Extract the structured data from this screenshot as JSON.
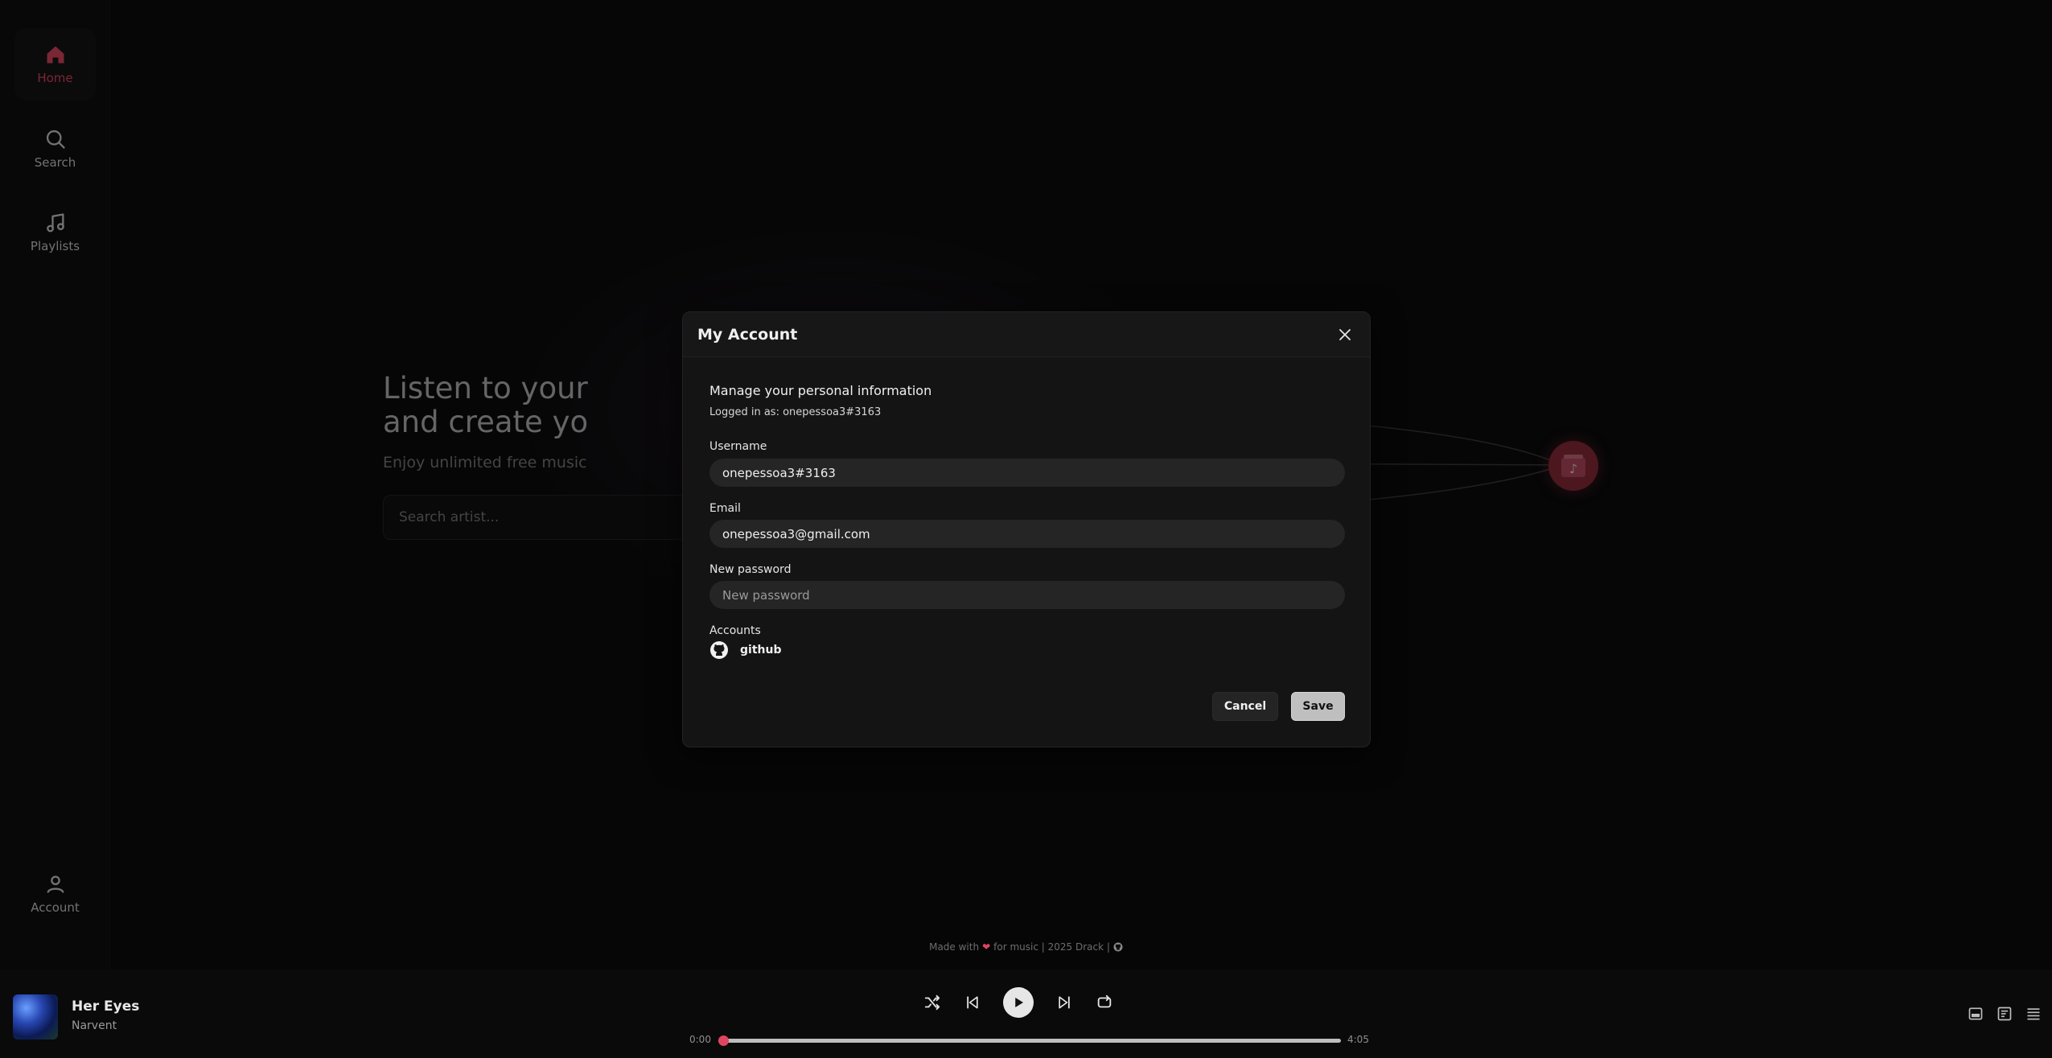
{
  "sidebar": {
    "items": [
      {
        "label": "Home",
        "icon": "home-icon",
        "active": true
      },
      {
        "label": "Search",
        "icon": "search-icon",
        "active": false
      },
      {
        "label": "Playlists",
        "icon": "music-note-icon",
        "active": false
      }
    ],
    "account": {
      "label": "Account",
      "icon": "user-icon"
    }
  },
  "hero": {
    "title": "Listen to your\nand create yo",
    "subtitle": "Enjoy unlimited free music",
    "search_placeholder": "Search artist..."
  },
  "modal": {
    "title": "My Account",
    "section_title": "Manage your personal information",
    "logged_in": "Logged in as: onepessoa3#3163",
    "username_label": "Username",
    "username_value": "onepessoa3#3163",
    "email_label": "Email",
    "email_value": "onepessoa3@gmail.com",
    "password_label": "New password",
    "password_placeholder": "New password",
    "accounts_label": "Accounts",
    "accounts": [
      {
        "name": "github",
        "icon": "github-icon"
      }
    ],
    "cancel_label": "Cancel",
    "save_label": "Save"
  },
  "footer": {
    "credit_prefix": "Made with",
    "credit_suffix": "for music | 2025 Drack |"
  },
  "player": {
    "track_title": "Her Eyes",
    "track_artist": "Narvent",
    "time_current": "0:00",
    "time_total": "4:05",
    "progress_fraction": 0.0
  },
  "colors": {
    "accent": "#e0455f",
    "background": "#0b0b0b",
    "modal_bg": "#141414"
  }
}
